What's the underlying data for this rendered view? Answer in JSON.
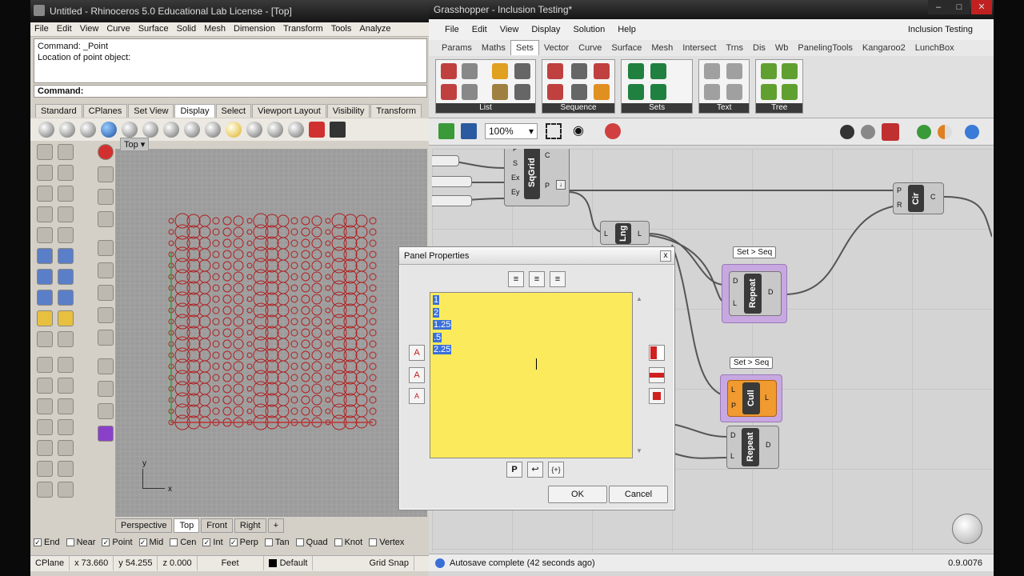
{
  "rhino": {
    "title": "Untitled - Rhinoceros 5.0 Educational Lab License - [Top]",
    "menu": [
      "File",
      "Edit",
      "View",
      "Curve",
      "Surface",
      "Solid",
      "Mesh",
      "Dimension",
      "Transform",
      "Tools",
      "Analyze"
    ],
    "command_history": [
      "Command: _Point",
      "Location of point object:"
    ],
    "command_prompt": "Command:",
    "toolbar_tabs": [
      "Standard",
      "CPlanes",
      "Set View",
      "Display",
      "Select",
      "Viewport Layout",
      "Visibility",
      "Transform"
    ],
    "active_toolbar_tab": "Display",
    "viewport_label": "Top",
    "view_tabs": [
      "Perspective",
      "Top",
      "Front",
      "Right"
    ],
    "active_view_tab": "Top",
    "add_view": "+",
    "osnaps": [
      {
        "label": "End",
        "checked": true
      },
      {
        "label": "Near",
        "checked": false
      },
      {
        "label": "Point",
        "checked": true
      },
      {
        "label": "Mid",
        "checked": true
      },
      {
        "label": "Cen",
        "checked": false
      },
      {
        "label": "Int",
        "checked": true
      },
      {
        "label": "Perp",
        "checked": true
      },
      {
        "label": "Tan",
        "checked": false
      },
      {
        "label": "Quad",
        "checked": false
      },
      {
        "label": "Knot",
        "checked": false
      },
      {
        "label": "Vertex",
        "checked": false
      }
    ],
    "status": {
      "cplane": "CPlane",
      "x": "x 73.660",
      "y": "y 54.255",
      "z": "z 0.000",
      "units": "Feet",
      "layer": "Default",
      "grid_snap": "Grid Snap"
    },
    "axis_x": "x",
    "axis_y": "y"
  },
  "grasshopper": {
    "title": "Grasshopper - Inclusion Testing*",
    "menu": [
      "File",
      "Edit",
      "View",
      "Display",
      "Solution",
      "Help"
    ],
    "document": "Inclusion Testing",
    "tabs": [
      "Params",
      "Maths",
      "Sets",
      "Vector",
      "Curve",
      "Surface",
      "Mesh",
      "Intersect",
      "Trns",
      "Dis",
      "Wb",
      "PanelingTools",
      "Kangaroo2",
      "LunchBox"
    ],
    "active_tab": "Sets",
    "ribbon_groups": [
      "List",
      "Sequence",
      "Sets",
      "Text",
      "Tree"
    ],
    "zoom": "100%",
    "status": "Autosave complete (42 seconds ago)",
    "version": "0.9.0076",
    "components": {
      "sqgrid": {
        "name": "SqGrid",
        "inputs": [
          "P",
          "S",
          "Ex",
          "Ey"
        ],
        "outputs": [
          "C",
          "P"
        ]
      },
      "lng": {
        "name": "Lng",
        "input": "L",
        "output": "L"
      },
      "cir": {
        "name": "Cir",
        "inputs": [
          "P",
          "R"
        ],
        "output": "C"
      },
      "repeat1": {
        "name": "Repeat",
        "inputs": [
          "D",
          "L"
        ],
        "output": "D",
        "tag": "Set > Seq"
      },
      "cull": {
        "name": "Cull",
        "inputs": [
          "L",
          "P"
        ],
        "output": "L",
        "tag": "Set > Seq"
      },
      "repeat2": {
        "name": "Repeat",
        "inputs": [
          "D",
          "L"
        ],
        "output": "D"
      }
    }
  },
  "dialog": {
    "title": "Panel Properties",
    "close": "x",
    "panel_lines": [
      "1",
      "2",
      "1.25",
      ".5",
      "2.25"
    ],
    "ok": "OK",
    "cancel": "Cancel",
    "bottom_buttons": [
      "P",
      "↩",
      "{+}"
    ]
  },
  "colors": {
    "panel_yellow": "#fbeb5c",
    "selection": "#3a6fd8",
    "point_red": "#b02020",
    "sets_purple": "#c8a8e0",
    "cull_orange": "#f09a30"
  }
}
